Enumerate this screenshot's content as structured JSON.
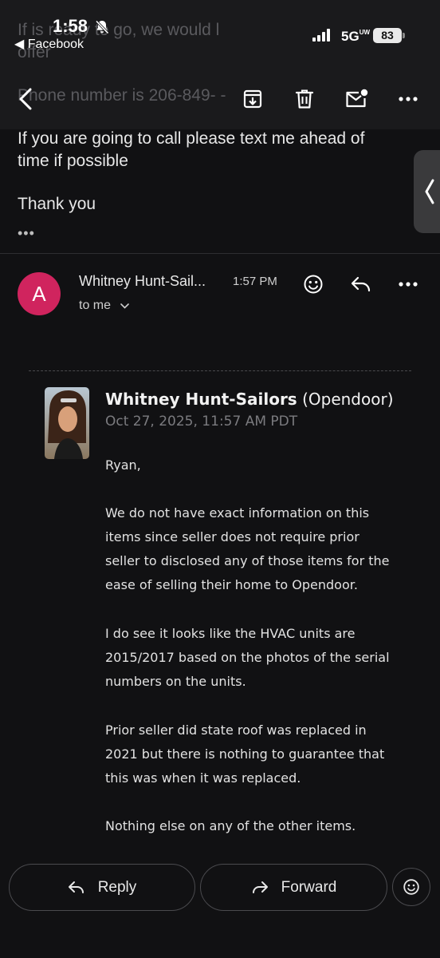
{
  "status_bar": {
    "time": "1:58",
    "back_app_label": "◀ Facebook",
    "network": "5G",
    "network_suffix": "UW",
    "battery": "83"
  },
  "ghost_text": {
    "line1": "If       is ready to go, we would l",
    "line2": "               offer",
    "line3": "Phone number is 206-849-  -  "
  },
  "previous_message": {
    "line1": "If you are going to call please text me ahead of",
    "line2": "time if possible",
    "line3": "Thank you",
    "ellipsis": "•••"
  },
  "message_header": {
    "avatar_letter": "A",
    "sender_name": "Whitney Hunt-Sail...",
    "time": "1:57 PM",
    "recipient": "to me"
  },
  "quoted": {
    "name": "Whitney Hunt-Sailors",
    "company": "(Opendoor)",
    "date": "Oct 27, 2025, 11:57 AM PDT",
    "body_lines": [
      "Ryan,",
      "We do not have exact information on this",
      "items since seller does not require prior",
      "seller to disclosed any of those items for the",
      "ease of selling their home to Opendoor.",
      "I do see it looks like the HVAC units are",
      "2015/2017 based on the photos of the serial",
      "numbers on the units.",
      "Prior seller did state roof was replaced in",
      "2021 but there is nothing to guarantee that",
      "this was when it was replaced.",
      "Nothing else on any of the other items."
    ]
  },
  "actions": {
    "reply": "Reply",
    "forward": "Forward"
  },
  "colors": {
    "background": "#111113",
    "toolbar": "#1a1a1c",
    "avatar": "#d0245e"
  }
}
